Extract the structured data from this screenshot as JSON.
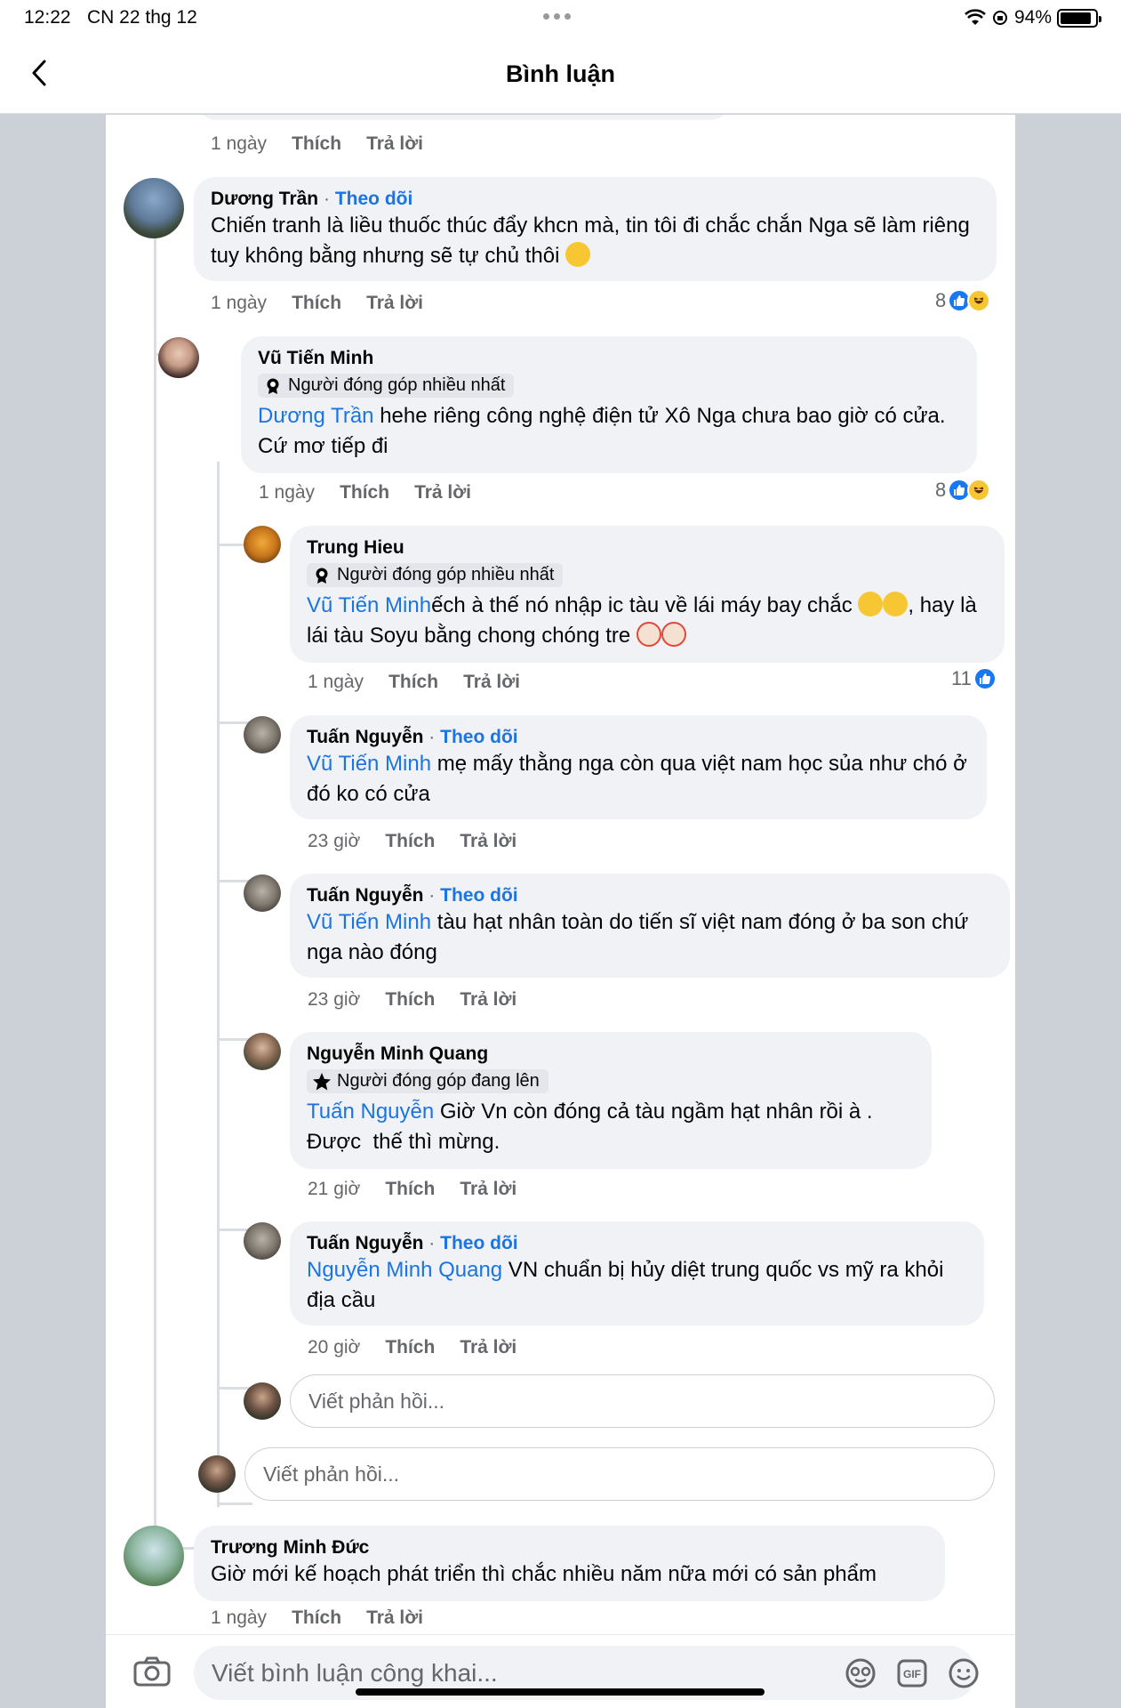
{
  "status": {
    "time": "12:22",
    "date": "CN 22 thg 12",
    "battery": "94%"
  },
  "nav": {
    "title": "Bình luận"
  },
  "top_actions": {
    "time": "1 ngày",
    "like": "Thích",
    "reply": "Trả lời"
  },
  "c1": {
    "name": "Dương Trần",
    "follow": "Theo dõi",
    "text": "Chiến tranh là liều thuốc thúc đẩy khcn mà, tin tôi đi chắc chắn Nga sẽ làm riêng tuy không bằng nhưng sẽ tự chủ thôi",
    "time": "1 ngày",
    "like": "Thích",
    "reply": "Trả lời",
    "count": "8"
  },
  "c2": {
    "name": "Vũ Tiến Minh",
    "badge": "Người đóng góp nhiều nhất",
    "mention": "Dương Trần",
    "text": " hehe riêng công nghệ điện tử Xô Nga chưa bao giờ có cửa. Cứ mơ tiếp đi",
    "time": "1 ngày",
    "like": "Thích",
    "reply": "Trả lời",
    "count": "8"
  },
  "c3": {
    "name": "Trung Hieu",
    "badge": "Người đóng góp nhiều nhất",
    "mention": "Vũ Tiến Minh",
    "text": "ếch à thế nó nhập ic tàu về lái máy bay chắc",
    "text2": ", hay là lái tàu Soyu bằng chong chóng tre",
    "time": "1 ngày",
    "like": "Thích",
    "reply": "Trả lời",
    "count": "11"
  },
  "c4": {
    "name": "Tuấn Nguyễn",
    "follow": "Theo dõi",
    "mention": "Vũ Tiến Minh",
    "text": " mẹ mấy thằng nga còn qua việt nam học sủa như chó ở đó ko có cửa",
    "time": "23 giờ",
    "like": "Thích",
    "reply": "Trả lời"
  },
  "c5": {
    "name": "Tuấn Nguyễn",
    "follow": "Theo dõi",
    "mention": "Vũ Tiến Minh",
    "text": " tàu hạt nhân toàn do tiến sĩ việt nam đóng ở ba son chứ nga nào đóng",
    "time": "23 giờ",
    "like": "Thích",
    "reply": "Trả lời"
  },
  "c6": {
    "name": "Nguyễn Minh Quang",
    "badge": "Người đóng góp đang lên",
    "mention": "Tuấn Nguyễn",
    "text": " Giờ Vn còn đóng cả tàu ngầm hạt nhân rồi à . Được  thế thì mừng.",
    "time": "21 giờ",
    "like": "Thích",
    "reply": "Trả lời"
  },
  "c7": {
    "name": "Tuấn Nguyễn",
    "follow": "Theo dõi",
    "mention": "Nguyễn Minh Quang",
    "text": " VN chuẩn bị hủy diệt trung quốc vs mỹ ra khỏi địa cầu",
    "time": "20 giờ",
    "like": "Thích",
    "reply": "Trả lời"
  },
  "reply_input_1": {
    "placeholder": "Viết phản hồi..."
  },
  "reply_input_2": {
    "placeholder": "Viết phản hồi..."
  },
  "c8": {
    "name": "Trương Minh Đức",
    "text": "Giờ mới kế hoạch phát triển thì chắc nhiều năm nữa mới có sản phẩm",
    "time": "1 ngày",
    "like": "Thích",
    "reply": "Trả lời"
  },
  "composer": {
    "placeholder": "Viết bình luận công khai..."
  },
  "icons": [
    "back-arrow",
    "wifi",
    "battery",
    "like",
    "haha",
    "camera",
    "avatar-sticker",
    "gif",
    "emoji"
  ],
  "colors": {
    "link": "#1b74e4",
    "bubble": "#f0f2f5",
    "secondary": "#65676b",
    "like_blue": "#1877f2"
  }
}
